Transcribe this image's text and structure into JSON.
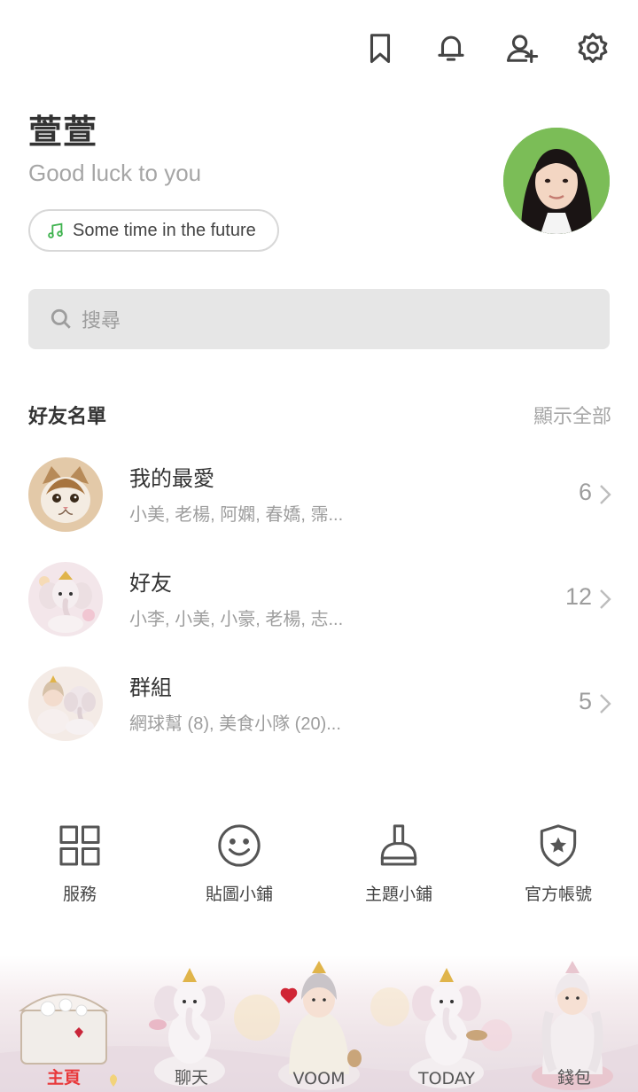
{
  "header": {
    "icons": [
      "bookmark-icon",
      "bell-icon",
      "add-friend-icon",
      "gear-icon"
    ]
  },
  "profile": {
    "name": "萱萱",
    "status": "Good luck to you",
    "music": "Some time in the future"
  },
  "search": {
    "placeholder": "搜尋"
  },
  "friends_section": {
    "title": "好友名單",
    "show_all": "顯示全部",
    "rows": [
      {
        "title": "我的最愛",
        "subtitle": "小美, 老楊, 阿嫻, 春嬌, 霈...",
        "count": "6"
      },
      {
        "title": "好友",
        "subtitle": "小李, 小美, 小豪, 老楊, 志...",
        "count": "12"
      },
      {
        "title": "群組",
        "subtitle": "網球幫 (8), 美食小隊 (20)...",
        "count": "5"
      }
    ]
  },
  "services": [
    {
      "label": "服務",
      "icon": "grid-icon"
    },
    {
      "label": "貼圖小鋪",
      "icon": "smiley-icon"
    },
    {
      "label": "主題小鋪",
      "icon": "brush-icon"
    },
    {
      "label": "官方帳號",
      "icon": "shield-star-icon"
    }
  ],
  "tabs": [
    {
      "label": "主頁",
      "active": true
    },
    {
      "label": "聊天",
      "active": false
    },
    {
      "label": "VOOM",
      "active": false
    },
    {
      "label": "TODAY",
      "active": false
    },
    {
      "label": "錢包",
      "active": false
    }
  ],
  "colors": {
    "accent_active": "#e8383a",
    "music_note": "#3fb34f",
    "search_bg": "#e6e6e6"
  }
}
